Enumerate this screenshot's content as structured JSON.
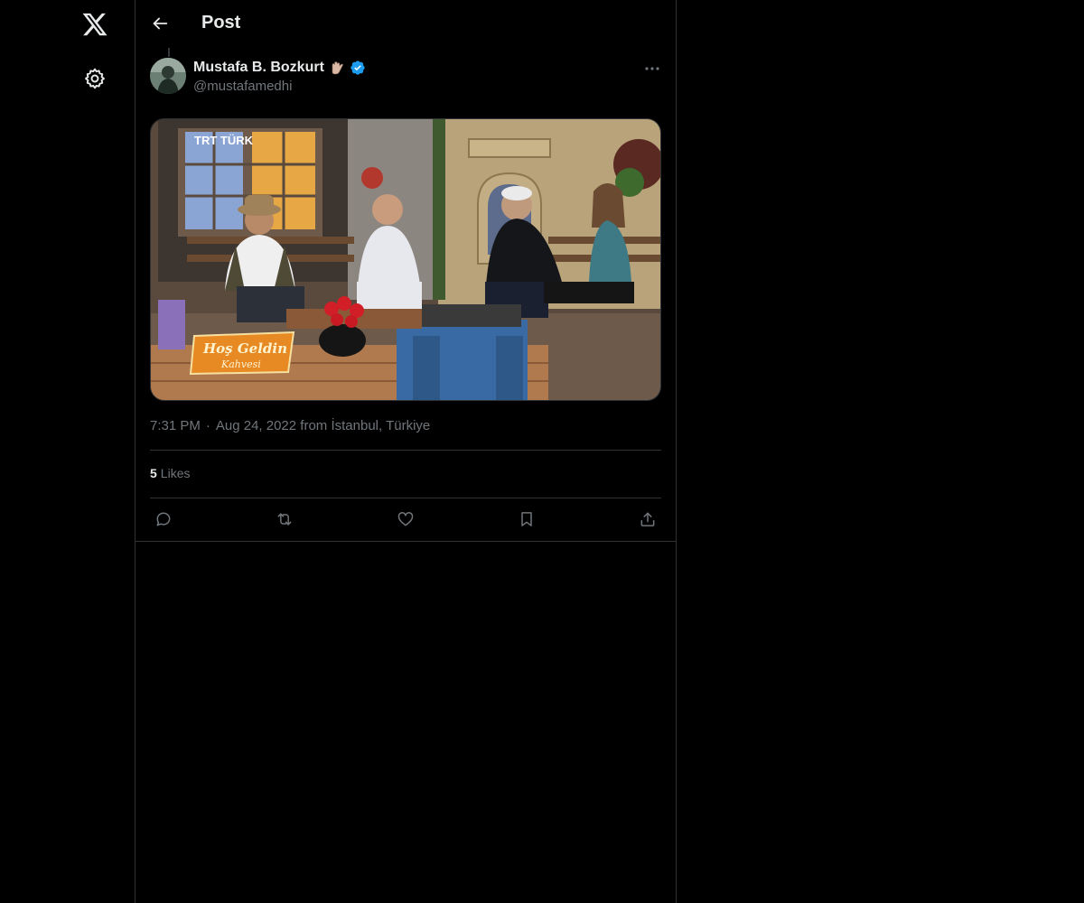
{
  "nav": {
    "logo_icon": "x-logo-icon",
    "settings_icon": "gear-icon"
  },
  "header": {
    "title": "Post",
    "back_icon": "arrow-left-icon"
  },
  "post": {
    "author_name": "Mustafa B. Bozkurt",
    "author_handle": "@mustafamedhi",
    "verified_icon": "verified-badge-icon",
    "name_emoji_icon": "hand-emoji-icon",
    "more_icon": "more-horizontal-icon",
    "media": {
      "channel_logo": "TRT TÜRK",
      "show_logo_line1": "Hoş Geldin",
      "show_logo_line2": "Kahvesi"
    },
    "time": "7:31 PM",
    "date": "Aug 24, 2022",
    "from_label": "from",
    "location": "İstanbul, Türkiye",
    "likes_count": "5",
    "likes_label": "Likes",
    "actions": [
      {
        "name": "reply",
        "icon": "reply-icon"
      },
      {
        "name": "repost",
        "icon": "repost-icon"
      },
      {
        "name": "like",
        "icon": "heart-icon"
      },
      {
        "name": "bookmark",
        "icon": "bookmark-icon"
      },
      {
        "name": "share",
        "icon": "share-icon"
      }
    ]
  },
  "colors": {
    "background": "#000000",
    "border": "#2f3336",
    "text_primary": "#e7e9ea",
    "text_secondary": "#71767b",
    "verified": "#1d9bf0"
  }
}
